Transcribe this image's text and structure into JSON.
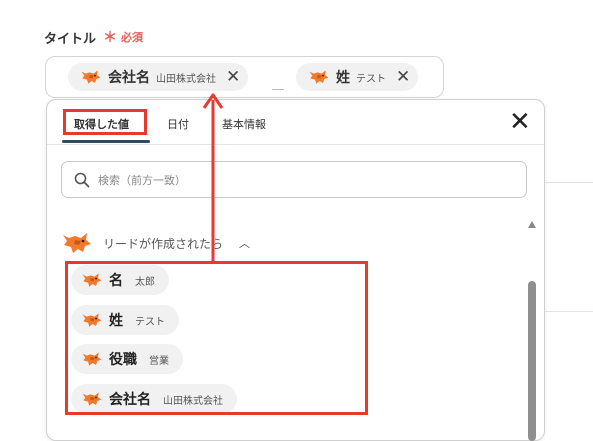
{
  "field": {
    "label": "タイトル",
    "required_star": "＊",
    "required_text": "必須"
  },
  "title_input": {
    "chips": [
      {
        "label": "会社名",
        "value": "山田株式会社",
        "remove": "✕"
      },
      {
        "label": "姓",
        "value": "テスト",
        "remove": "✕"
      }
    ],
    "separator": "＿"
  },
  "panel": {
    "tabs": [
      {
        "label": "取得した値",
        "active": true
      },
      {
        "label": "日付",
        "active": false
      },
      {
        "label": "基本情報",
        "active": false
      }
    ],
    "close": "✕",
    "search_placeholder": "検索（前方一致）",
    "section": {
      "title": "リードが作成されたら",
      "chevron": "︿"
    },
    "items": [
      {
        "label": "名",
        "value": "太郎"
      },
      {
        "label": "姓",
        "value": "テスト"
      },
      {
        "label": "役職",
        "value": "営業"
      },
      {
        "label": "会社名",
        "value": "山田株式会社"
      }
    ]
  },
  "colors": {
    "brand_orange": "#f07a2e",
    "highlight_red": "#e8392f",
    "required_red": "#e8605b",
    "tab_underline": "#2e4a5e",
    "chip_bg": "#f1f1f2"
  },
  "icons": [
    "fox-icon",
    "close-icon",
    "search-icon",
    "chevron-up-icon",
    "scroll-up-icon"
  ]
}
